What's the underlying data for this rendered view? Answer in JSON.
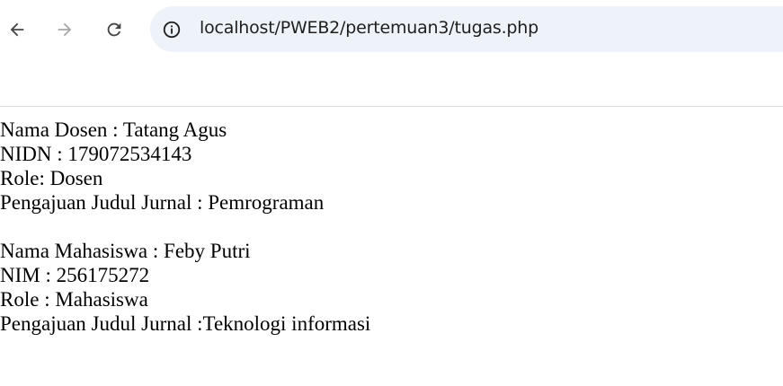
{
  "browser": {
    "back_icon": "arrow-left-icon",
    "forward_icon": "arrow-right-icon",
    "reload_icon": "reload-icon",
    "site_info_icon": "info-circle-icon",
    "url": "localhost/PWEB2/pertemuan3/tugas.php"
  },
  "page": {
    "dosen": {
      "nama": "Nama Dosen : Tatang Agus",
      "nidn": "NIDN : 179072534143",
      "role": "Role: Dosen",
      "judul": "Pengajuan Judul Jurnal : Pemrograman"
    },
    "mahasiswa": {
      "nama": "Nama Mahasiswa : Feby Putri",
      "nim": "NIM : 256175272",
      "role": "Role : Mahasiswa",
      "judul": "Pengajuan Judul Jurnal :Teknologi informasi"
    }
  },
  "colors": {
    "omnibox_bg": "#eef2f9",
    "icon_active": "#474747",
    "icon_disabled": "#a8a8a8",
    "divider": "#dadce0"
  }
}
